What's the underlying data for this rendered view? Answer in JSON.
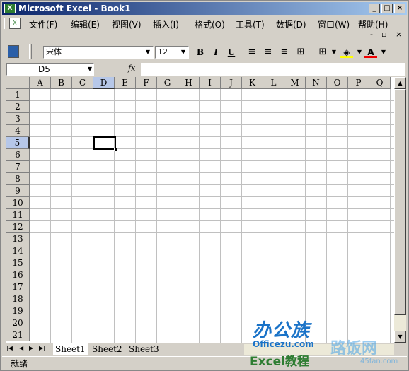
{
  "window": {
    "title": "Microsoft Excel - Book1",
    "buttons": [
      "_",
      "□",
      "×"
    ]
  },
  "menubar": {
    "items": [
      "文件(F)",
      "编辑(E)",
      "视图(V)",
      "插入(I)",
      "格式(O)",
      "工具(T)",
      "数据(D)",
      "窗口(W)",
      "帮助(H)"
    ],
    "doc_controls": [
      "×",
      "▫",
      "×"
    ]
  },
  "toolbar": {
    "font": "宋体",
    "size": "12",
    "bold": "B",
    "italic": "I",
    "underline": "U",
    "font_color_label": "A"
  },
  "formula_bar": {
    "name_box": "D5",
    "fx": "fx",
    "value": ""
  },
  "grid": {
    "columns": [
      "A",
      "B",
      "C",
      "D",
      "E",
      "F",
      "G",
      "H",
      "I",
      "J",
      "K",
      "L",
      "M",
      "N",
      "O",
      "P",
      "Q"
    ],
    "rows": [
      "1",
      "2",
      "3",
      "4",
      "5",
      "6",
      "7",
      "8",
      "9",
      "10",
      "11",
      "12",
      "13",
      "14",
      "15",
      "16",
      "17",
      "18",
      "19",
      "20",
      "21"
    ],
    "active_cell": "D5"
  },
  "sheets": {
    "tabs": [
      "Sheet1",
      "Sheet2",
      "Sheet3"
    ],
    "active": "Sheet1"
  },
  "status": {
    "text": "就绪"
  },
  "watermark": {
    "logo": "办公族",
    "site": "Officezu.com",
    "excel": "Excel教程",
    "right": "路饭网",
    "right_site": "45fan.com"
  }
}
